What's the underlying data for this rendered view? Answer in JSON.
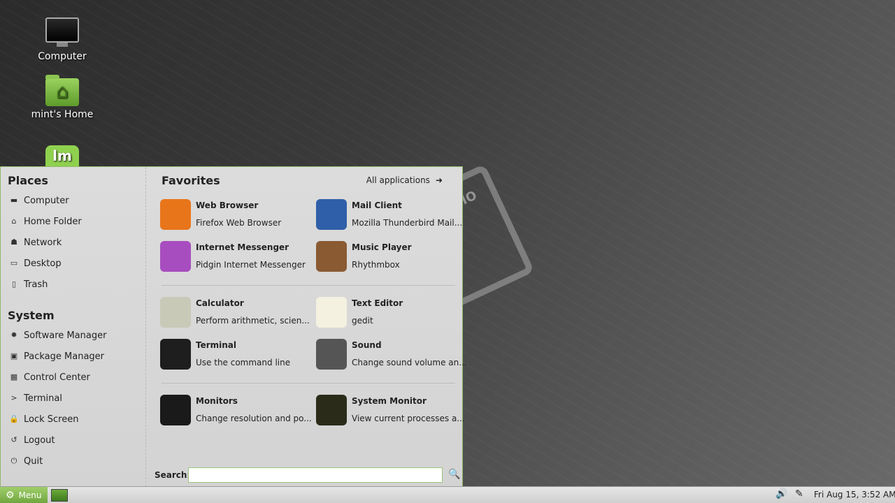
{
  "desktop": {
    "icons": [
      {
        "label": "Computer"
      },
      {
        "label": "mint's Home"
      },
      {
        "label": "lm"
      }
    ]
  },
  "menu": {
    "places_title": "Places",
    "places": [
      {
        "label": "Computer",
        "icon": "computer-icon"
      },
      {
        "label": "Home Folder",
        "icon": "home-icon"
      },
      {
        "label": "Network",
        "icon": "network-icon"
      },
      {
        "label": "Desktop",
        "icon": "desktop-icon"
      },
      {
        "label": "Trash",
        "icon": "trash-icon"
      }
    ],
    "system_title": "System",
    "system": [
      {
        "label": "Software Manager",
        "icon": "software-manager-icon"
      },
      {
        "label": "Package Manager",
        "icon": "package-manager-icon"
      },
      {
        "label": "Control Center",
        "icon": "control-center-icon"
      },
      {
        "label": "Terminal",
        "icon": "terminal-icon"
      },
      {
        "label": "Lock Screen",
        "icon": "lock-icon"
      },
      {
        "label": "Logout",
        "icon": "logout-icon"
      },
      {
        "label": "Quit",
        "icon": "power-icon"
      }
    ],
    "favorites_title": "Favorites",
    "all_applications": "All applications",
    "favorites": [
      {
        "name": "Web Browser",
        "desc": "Firefox Web Browser",
        "icon": "firefox-icon",
        "color": "#e8751a"
      },
      {
        "name": "Mail Client",
        "desc": "Mozilla Thunderbird Mail...",
        "icon": "thunderbird-icon",
        "color": "#2f5fa8"
      },
      {
        "name": "Internet Messenger",
        "desc": "Pidgin Internet Messenger",
        "icon": "pidgin-icon",
        "color": "#a84dbf"
      },
      {
        "name": "Music Player",
        "desc": "Rhythmbox",
        "icon": "rhythmbox-icon",
        "color": "#8a5a33"
      },
      {
        "name": "Calculator",
        "desc": "Perform arithmetic, scien...",
        "icon": "calculator-icon",
        "color": "#c9c9b8"
      },
      {
        "name": "Text Editor",
        "desc": "gedit",
        "icon": "text-editor-icon",
        "color": "#f4f1e0"
      },
      {
        "name": "Terminal",
        "desc": "Use the command line",
        "icon": "terminal-icon",
        "color": "#1e1e1e"
      },
      {
        "name": "Sound",
        "desc": "Change sound volume an...",
        "icon": "sound-icon",
        "color": "#555555"
      },
      {
        "name": "Monitors",
        "desc": "Change resolution and po...",
        "icon": "monitors-icon",
        "color": "#1a1a1a"
      },
      {
        "name": "System Monitor",
        "desc": "View current processes a...",
        "icon": "system-monitor-icon",
        "color": "#2b2b1a"
      }
    ],
    "search_label": "Search:",
    "search_value": ""
  },
  "panel": {
    "menu_label": "Menu",
    "clock": "Fri Aug 15,  3:52 AM"
  }
}
